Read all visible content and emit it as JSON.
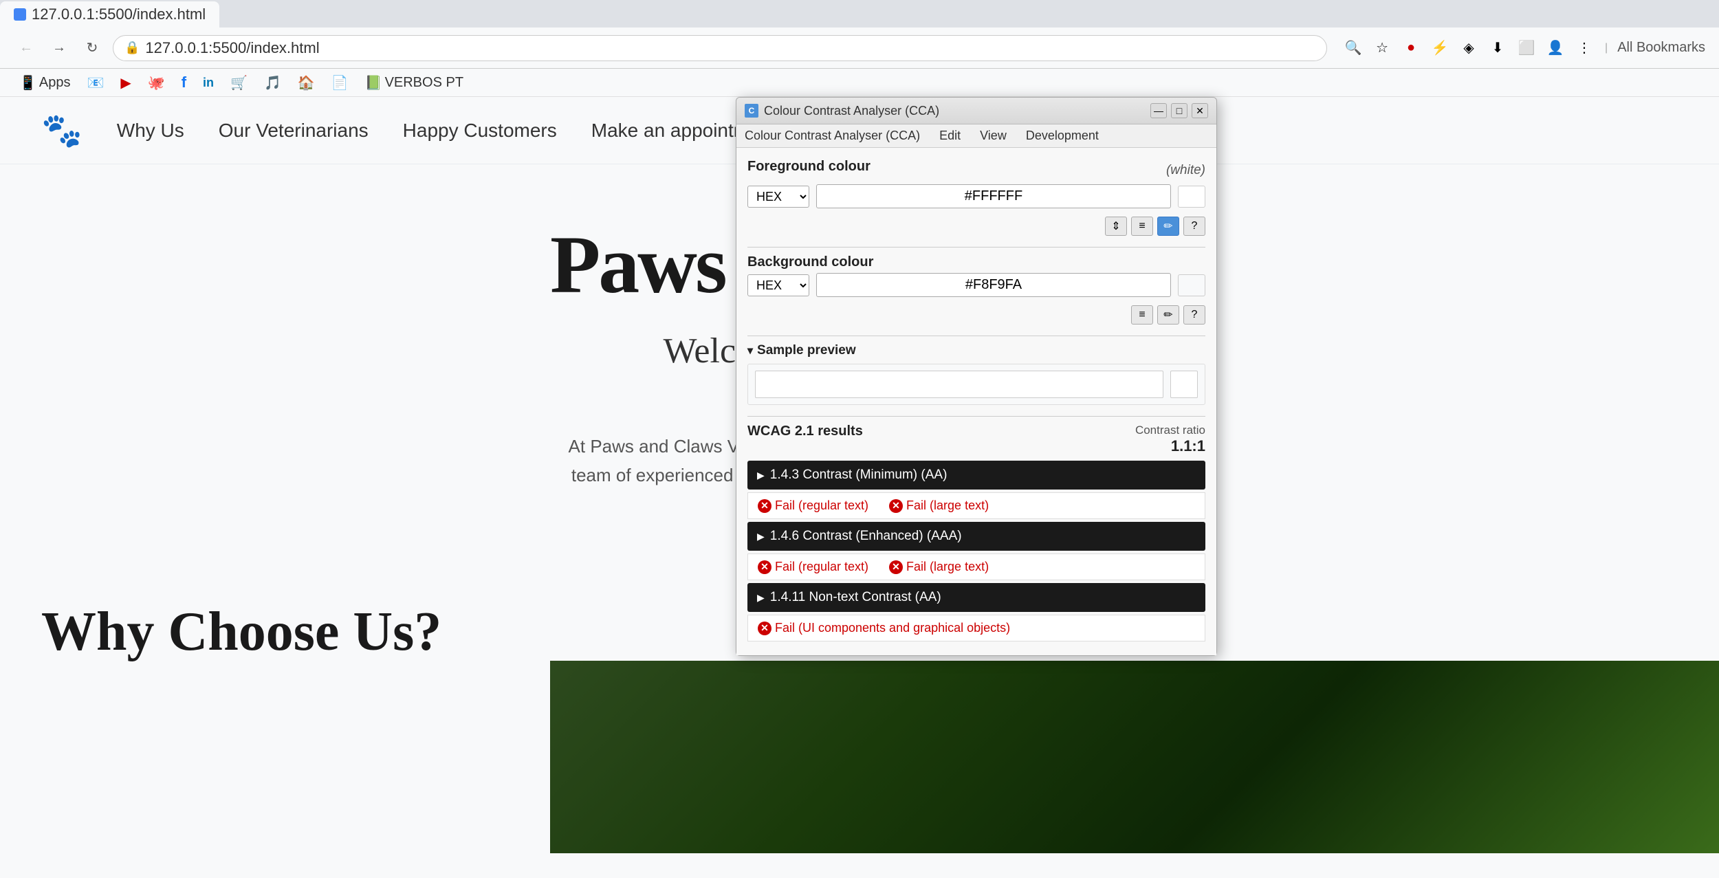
{
  "browser": {
    "tab_title": "127.0.0.1:5500/index.html",
    "address": "127.0.0.1:5500/index.html",
    "bookmarks": [
      {
        "id": "apps",
        "label": "Apps"
      },
      {
        "id": "gmail",
        "label": ""
      },
      {
        "id": "youtube",
        "label": ""
      },
      {
        "id": "github",
        "label": ""
      },
      {
        "id": "facebook",
        "label": ""
      },
      {
        "id": "linkedin",
        "label": ""
      },
      {
        "id": "amazon",
        "label": ""
      },
      {
        "id": "pandora",
        "label": ""
      },
      {
        "id": "wayfair",
        "label": ""
      },
      {
        "id": "docs",
        "label": ""
      },
      {
        "id": "verbos",
        "label": "VERBOS PT"
      }
    ],
    "all_bookmarks_label": "All Bookmarks"
  },
  "site": {
    "nav": {
      "logo_emoji": "🐾",
      "links": [
        {
          "id": "why-us",
          "label": "Why Us"
        },
        {
          "id": "vets",
          "label": "Our Veterinarians"
        },
        {
          "id": "customers",
          "label": "Happy Customers"
        },
        {
          "id": "appointment",
          "label": "Make an appointment"
        }
      ]
    },
    "hero": {
      "title": "Paws and Claws V",
      "subtitle": "Welcome to Our Veterinary Services",
      "description": "At Paws and Claws Vet, we prioritize the health and well-being of your bel team of experienced veterinarians is dedicated to providing top-notch car cats."
    },
    "why_section": {
      "title": "Why Choose Us?"
    }
  },
  "cca": {
    "window_title": "Colour Contrast Analyser (CCA)",
    "menu_items": [
      "Colour Contrast Analyser (CCA)",
      "Edit",
      "View",
      "Development"
    ],
    "foreground": {
      "label": "Foreground colour",
      "white_label": "(white)",
      "format": "HEX",
      "value": "#FFFFFF",
      "swatch_color": "#ffffff"
    },
    "background": {
      "label": "Background colour",
      "format": "HEX",
      "value": "#F8F9FA",
      "swatch_color": "#f8f9fa"
    },
    "sample_preview": {
      "label": "Sample preview"
    },
    "wcag": {
      "title": "WCAG 2.1 results",
      "contrast_ratio_label": "Contrast ratio",
      "contrast_ratio_value": "1.1:1",
      "results": [
        {
          "id": "1-4-3",
          "label": "1.4.3 Contrast (Minimum) (AA)",
          "details": [
            {
              "type": "fail",
              "label": "Fail (regular text)"
            },
            {
              "type": "fail",
              "label": "Fail (large text)"
            }
          ]
        },
        {
          "id": "1-4-6",
          "label": "1.4.6 Contrast (Enhanced) (AAA)",
          "details": [
            {
              "type": "fail",
              "label": "Fail (regular text)"
            },
            {
              "type": "fail",
              "label": "Fail (large text)"
            }
          ]
        },
        {
          "id": "1-4-11",
          "label": "1.4.11 Non-text Contrast (AA)",
          "details": [
            {
              "type": "fail",
              "label": "Fail (UI components and graphical objects)"
            }
          ]
        }
      ]
    },
    "icons": {
      "adjust": "⇕",
      "sliders": "≡",
      "eyedropper": "✏",
      "help": "?",
      "close": "✕",
      "minimize": "—",
      "maximize": "□"
    }
  }
}
